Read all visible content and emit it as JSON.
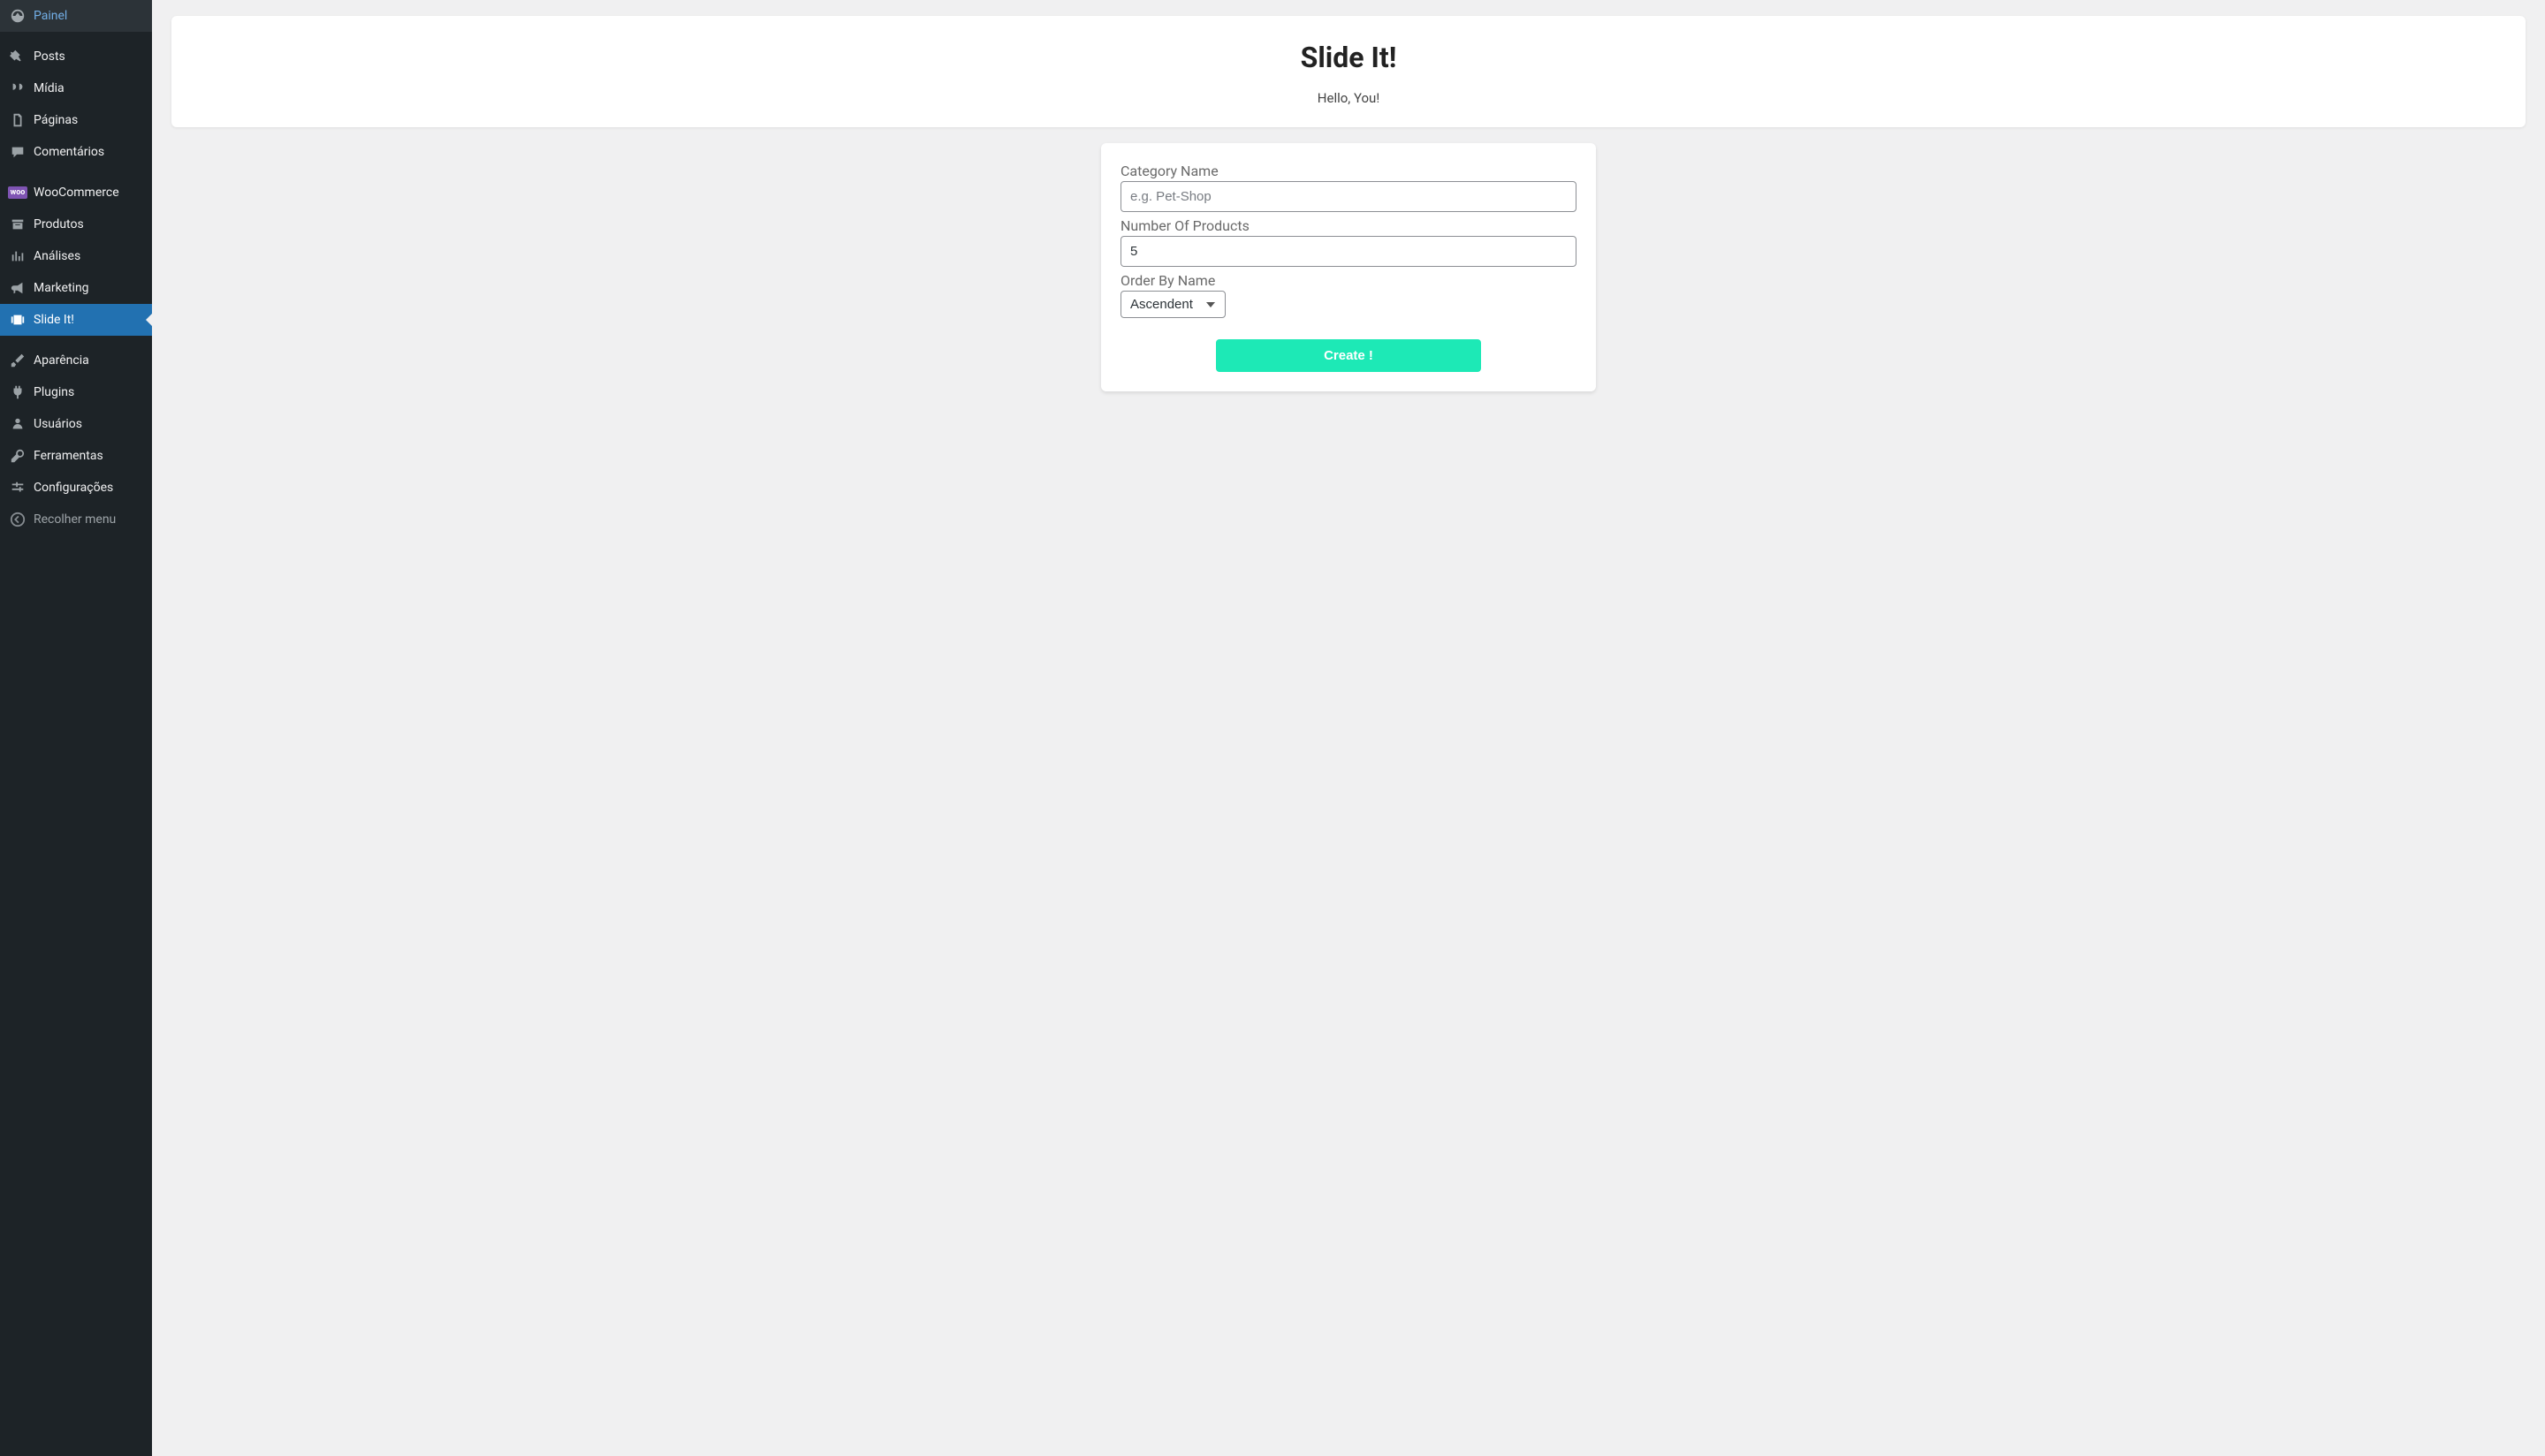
{
  "sidebar": {
    "items": [
      {
        "label": "Painel",
        "icon": "dashboard"
      },
      {
        "label": "Posts",
        "icon": "pin"
      },
      {
        "label": "Mídia",
        "icon": "media"
      },
      {
        "label": "Páginas",
        "icon": "pages"
      },
      {
        "label": "Comentários",
        "icon": "comment"
      },
      {
        "label": "WooCommerce",
        "icon": "woo"
      },
      {
        "label": "Produtos",
        "icon": "archive"
      },
      {
        "label": "Análises",
        "icon": "analytics"
      },
      {
        "label": "Marketing",
        "icon": "megaphone"
      },
      {
        "label": "Slide It!",
        "icon": "slides",
        "active": true
      },
      {
        "label": "Aparência",
        "icon": "brush"
      },
      {
        "label": "Plugins",
        "icon": "plug"
      },
      {
        "label": "Usuários",
        "icon": "user"
      },
      {
        "label": "Ferramentas",
        "icon": "wrench"
      },
      {
        "label": "Configurações",
        "icon": "settings"
      }
    ],
    "collapse_label": "Recolher menu"
  },
  "header": {
    "title": "Slide It!",
    "subtitle": "Hello, You!"
  },
  "form": {
    "category_label": "Category Name",
    "category_placeholder": "e.g. Pet-Shop",
    "category_value": "",
    "number_label": "Number Of Products",
    "number_value": "5",
    "order_label": "Order By Name",
    "order_selected": "Ascendent",
    "create_label": "Create !"
  }
}
